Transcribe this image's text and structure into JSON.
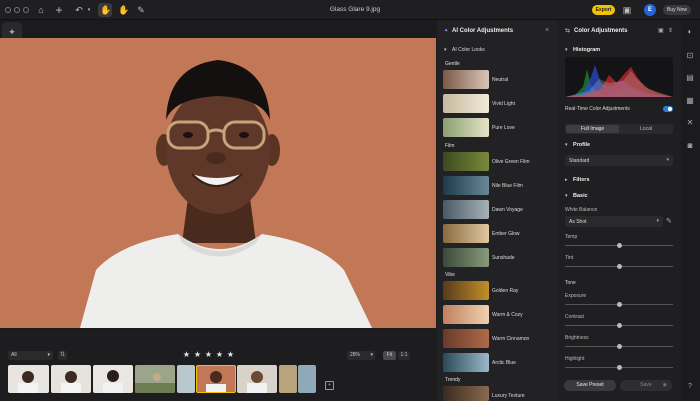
{
  "window": {
    "title": "Glass Glare 9.jpg"
  },
  "toolbar": {
    "export_label": "Export",
    "avatar_initial": "E",
    "buy_label": "Buy Now"
  },
  "filmstrip": {
    "filter": "All",
    "zoom": "28%",
    "fit": "Fit",
    "one_to_one": "1:1",
    "stars": [
      "★",
      "★",
      "★",
      "★",
      "★"
    ]
  },
  "ai_panel": {
    "title": "AI Color Adjustments",
    "looks_header": "AI Color Looks",
    "groups": [
      {
        "name": "Gentle",
        "items": [
          "Neutral",
          "Vivid Light",
          "Pure Love"
        ]
      },
      {
        "name": "Film",
        "items": [
          "Olive Green Film",
          "Nile Blue Film",
          "Dawn Voyage",
          "Ember Glow",
          "Sunshade"
        ]
      },
      {
        "name": "Vibe",
        "items": [
          "Golden Ray",
          "Warm & Cozy",
          "Warm Cinnamon",
          "Arctic Blue"
        ]
      },
      {
        "name": "Trendy",
        "items": [
          "Luxury Texture"
        ]
      }
    ]
  },
  "color_panel": {
    "title": "Color Adjustments",
    "histogram_label": "Histogram",
    "realtime_label": "Real-Time Color Adjustments",
    "tabs": [
      "Full Image",
      "Local"
    ],
    "profile_label": "Profile",
    "profile_value": "Standard",
    "filters_label": "Filters",
    "basic_label": "Basic",
    "wb_label": "White Balance",
    "wb_value": "As Shot",
    "sliders": [
      {
        "label": "Temp",
        "value": 0.5
      },
      {
        "label": "Tint",
        "value": 0.5
      }
    ],
    "tone_label": "Tone",
    "tone_sliders": [
      {
        "label": "Exposure",
        "value": 0.5
      },
      {
        "label": "Contrast",
        "value": 0.5
      },
      {
        "label": "Brightness",
        "value": 0.5
      },
      {
        "label": "Highlight",
        "value": 0.5
      }
    ],
    "save_preset": "Save Preset",
    "save": "Save"
  },
  "colors": {
    "accent": "#f2c400",
    "toggle": "#2a7de1",
    "backdrop": "#c27857"
  }
}
